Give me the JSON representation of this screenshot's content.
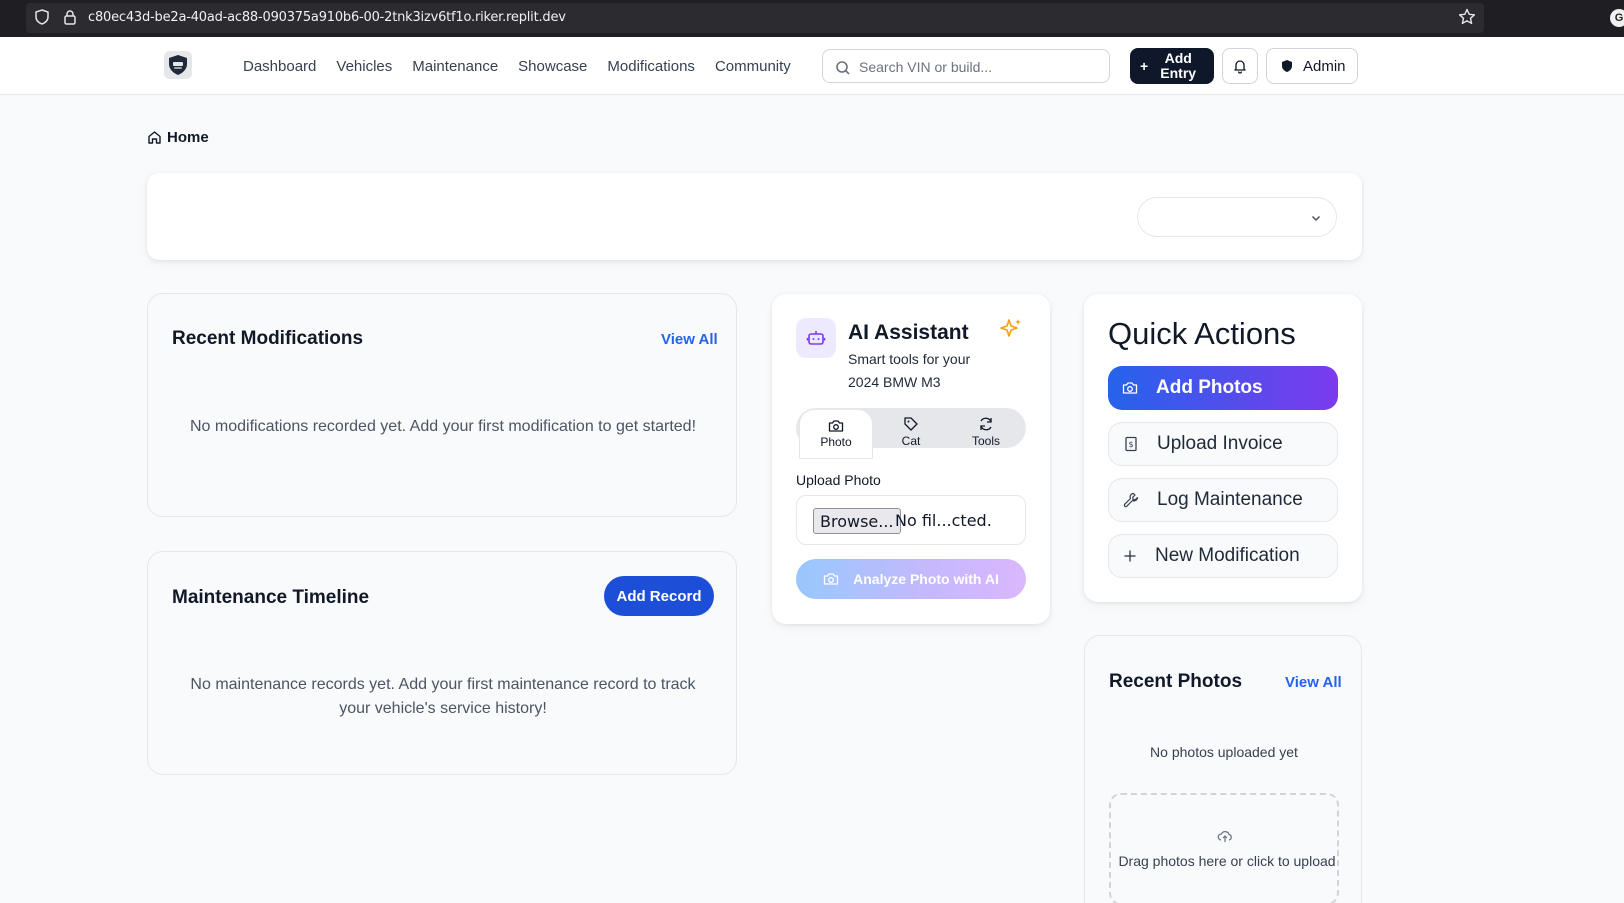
{
  "browser": {
    "url": "c80ec43d-be2a-40ad-ac88-090375a910b6-00-2tnk3izv6tf1o.riker.replit.dev",
    "extension_badge": "G"
  },
  "nav": {
    "links": [
      "Dashboard",
      "Vehicles",
      "Maintenance",
      "Showcase",
      "Modifications",
      "Community"
    ],
    "search_placeholder": "Search VIN or build...",
    "add_entry_label": "Add Entry",
    "admin_label": "Admin"
  },
  "breadcrumb": {
    "home": "Home"
  },
  "vehicle_selector": {
    "value": ""
  },
  "recent_modifications": {
    "title": "Recent Modifications",
    "view_all": "View All",
    "empty": "No modifications recorded yet. Add your first modification to get started!"
  },
  "maintenance_timeline": {
    "title": "Maintenance Timeline",
    "add_record": "Add Record",
    "empty": "No maintenance records yet. Add your first maintenance record to track your vehicle's service history!"
  },
  "ai_assistant": {
    "title": "AI Assistant",
    "subtitle": "Smart tools for your 2024 BMW M3",
    "tabs": [
      "Photo",
      "Cat",
      "Tools"
    ],
    "active_tab": "Photo",
    "upload_label": "Upload Photo",
    "browse_label": "Browse...",
    "file_status": "No fil...cted.",
    "analyze_label": "Analyze Photo with AI"
  },
  "quick_actions": {
    "title": "Quick Actions",
    "buttons": [
      "Add Photos",
      "Upload Invoice",
      "Log Maintenance",
      "New Modification"
    ]
  },
  "recent_photos": {
    "title": "Recent Photos",
    "view_all": "View All",
    "empty": "No photos uploaded yet",
    "drop_text": "Drag photos here or click to upload"
  },
  "colors": {
    "primary": "#1d4ed8",
    "link": "#2563eb",
    "gradient_start": "#2563eb",
    "gradient_end": "#7c3aed",
    "nav_dark": "#0f172a"
  }
}
